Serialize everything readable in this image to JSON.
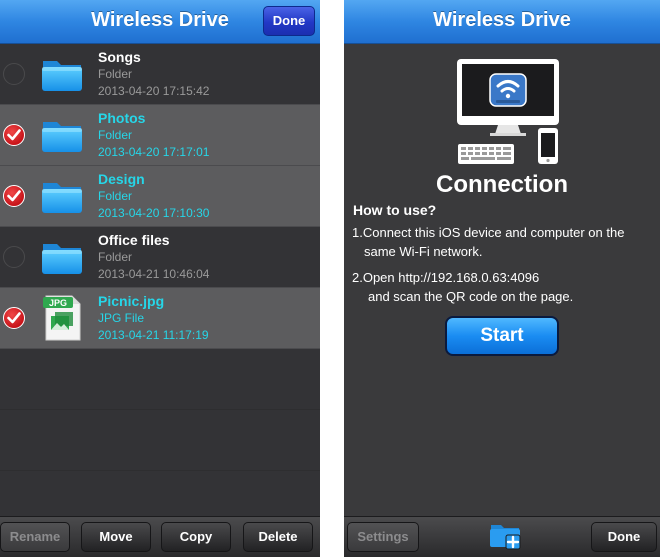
{
  "left": {
    "title": "Wireless Drive",
    "done_label": "Done",
    "files": [
      {
        "name": "Songs",
        "type": "Folder",
        "date": "2013-04-20 17:15:42",
        "selected": false,
        "icon": "folder-icon"
      },
      {
        "name": "Photos",
        "type": "Folder",
        "date": "2013-04-20 17:17:01",
        "selected": true,
        "icon": "folder-icon"
      },
      {
        "name": "Design",
        "type": "Folder",
        "date": "2013-04-20 17:10:30",
        "selected": true,
        "icon": "folder-icon"
      },
      {
        "name": "Office files",
        "type": "Folder",
        "date": "2013-04-21 10:46:04",
        "selected": false,
        "icon": "folder-icon"
      },
      {
        "name": "Picnic.jpg",
        "type": "JPG File",
        "date": "2013-04-21 11:17:19",
        "selected": true,
        "icon": "jpg-file-icon",
        "badge": "JPG"
      }
    ],
    "toolbar": {
      "rename": "Rename",
      "move": "Move",
      "copy": "Copy",
      "delete": "Delete"
    }
  },
  "right": {
    "title": "Wireless Drive",
    "connection_title": "Connection",
    "how_to": "How to use?",
    "step1_line1": "1.Connect this iOS device and computer on the",
    "step1_line2": "same Wi-Fi network.",
    "step2_line1": "2.Open http://192.168.0.63:4096",
    "step2_line2": "and scan the QR code on the page.",
    "start_label": "Start",
    "toolbar": {
      "settings": "Settings",
      "done": "Done",
      "add_icon": "add-folder-icon"
    }
  },
  "colors": {
    "nav_blue": "#2f86e2",
    "selected_text": "#26d6e8",
    "check_red": "#d0161c",
    "start_blue": "#1a8cf2"
  }
}
